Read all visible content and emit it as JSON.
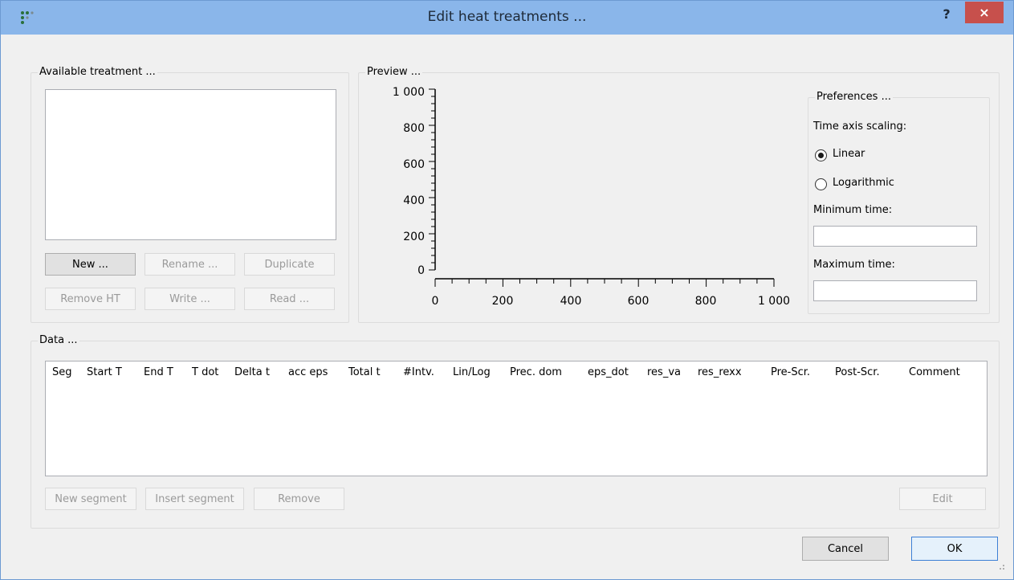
{
  "window": {
    "title": "Edit heat treatments ...",
    "help_label": "?",
    "close_label": "×"
  },
  "available": {
    "title": "Available treatment ...",
    "buttons": {
      "new": "New ...",
      "rename": "Rename ...",
      "duplicate": "Duplicate",
      "remove_ht": "Remove HT",
      "write": "Write ...",
      "read": "Read ..."
    }
  },
  "preview": {
    "title": "Preview ...",
    "y_ticks": [
      "1 000",
      "800",
      "600",
      "400",
      "200",
      "0"
    ],
    "x_ticks": [
      "0",
      "200",
      "400",
      "600",
      "800",
      "1 000"
    ]
  },
  "preferences": {
    "title": "Preferences ...",
    "time_axis_label": "Time axis scaling:",
    "linear_label": "Linear",
    "log_label": "Logarithmic",
    "selected": "Linear",
    "min_time_label": "Minimum time:",
    "min_time_value": "",
    "max_time_label": "Maximum time:",
    "max_time_value": ""
  },
  "data": {
    "title": "Data ...",
    "columns": [
      "Seg",
      "Start T",
      "End T",
      "T dot",
      "Delta t",
      "acc eps",
      "Total t",
      "#Intv.",
      "Lin/Log",
      "Prec. dom",
      "eps_dot",
      "res_va",
      "res_rexx",
      "Pre-Scr.",
      "Post-Scr.",
      "Comment"
    ],
    "buttons": {
      "new_segment": "New segment",
      "insert_segment": "Insert segment",
      "remove": "Remove",
      "edit": "Edit"
    }
  },
  "footer": {
    "cancel": "Cancel",
    "ok": "OK"
  },
  "colors": {
    "titlebar": "#8ab6ea",
    "close": "#c7504c"
  }
}
